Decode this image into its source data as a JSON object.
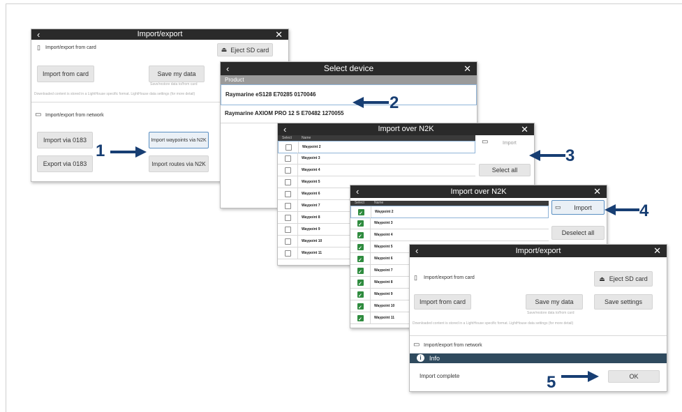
{
  "colors": {
    "titlebar": "#2a2a2a",
    "callout": "#173e73",
    "check": "#2e8b3e",
    "highlight": "#5a8fc2"
  },
  "panel1": {
    "title": "Import/export",
    "card_section": "Import/export from card",
    "eject": "Eject SD card",
    "import_card": "Import from card",
    "save_data": "Save my data",
    "save_sub": "Save/restore data to/from card",
    "note": "Downloaded content is stored in a LightHouse specific format. LightHouse data settings (for more detail)",
    "network_section": "Import/export from network",
    "import_0183": "Import via 0183",
    "import_waypoints": "Import waypoints via N2K",
    "export_0183": "Export via 0183",
    "import_routes": "Import routes via N2K"
  },
  "panel2": {
    "title": "Select device",
    "header": "Product",
    "devices": [
      "Raymarine eS128   E70285 0170046",
      "Raymarine AXIOM PRO 12 S   E70482 1270055"
    ]
  },
  "panel3": {
    "title": "Import over N2K",
    "col_select": "Select",
    "col_name": "Name",
    "import": "Import",
    "select_all": "Select all",
    "rows": [
      "Waypoint 2",
      "Waypoint 3",
      "Waypoint 4",
      "Waypoint 5",
      "Waypoint 6",
      "Waypoint 7",
      "Waypoint 8",
      "Waypoint 9",
      "Waypoint 10",
      "Waypoint 11"
    ]
  },
  "panel4": {
    "title": "Import over N2K",
    "col_select": "Select",
    "col_name": "Name",
    "import": "Import",
    "deselect_all": "Deselect all",
    "rows": [
      "Waypoint 2",
      "Waypoint 3",
      "Waypoint 4",
      "Waypoint 5",
      "Waypoint 6",
      "Waypoint 7",
      "Waypoint 8",
      "Waypoint 9",
      "Waypoint 10",
      "Waypoint 11"
    ]
  },
  "panel5": {
    "title": "Import/export",
    "card_section": "Import/export from card",
    "eject": "Eject SD card",
    "import_card": "Import from card",
    "save_data": "Save my data",
    "save_sub": "Save/restore data to/from card",
    "save_settings": "Save settings",
    "note": "Downloaded content is stored in a LightHouse specific format. LightHouse data settings (for more detail)",
    "network_section": "Import/export from network",
    "info": "Info",
    "message": "Import complete",
    "ok": "OK"
  },
  "steps": [
    "1",
    "2",
    "3",
    "4",
    "5"
  ],
  "icons": {
    "back": "‹",
    "close": "✕",
    "card": "🗒",
    "network": "🖵",
    "eject": "⏏",
    "info": "ℹ"
  }
}
